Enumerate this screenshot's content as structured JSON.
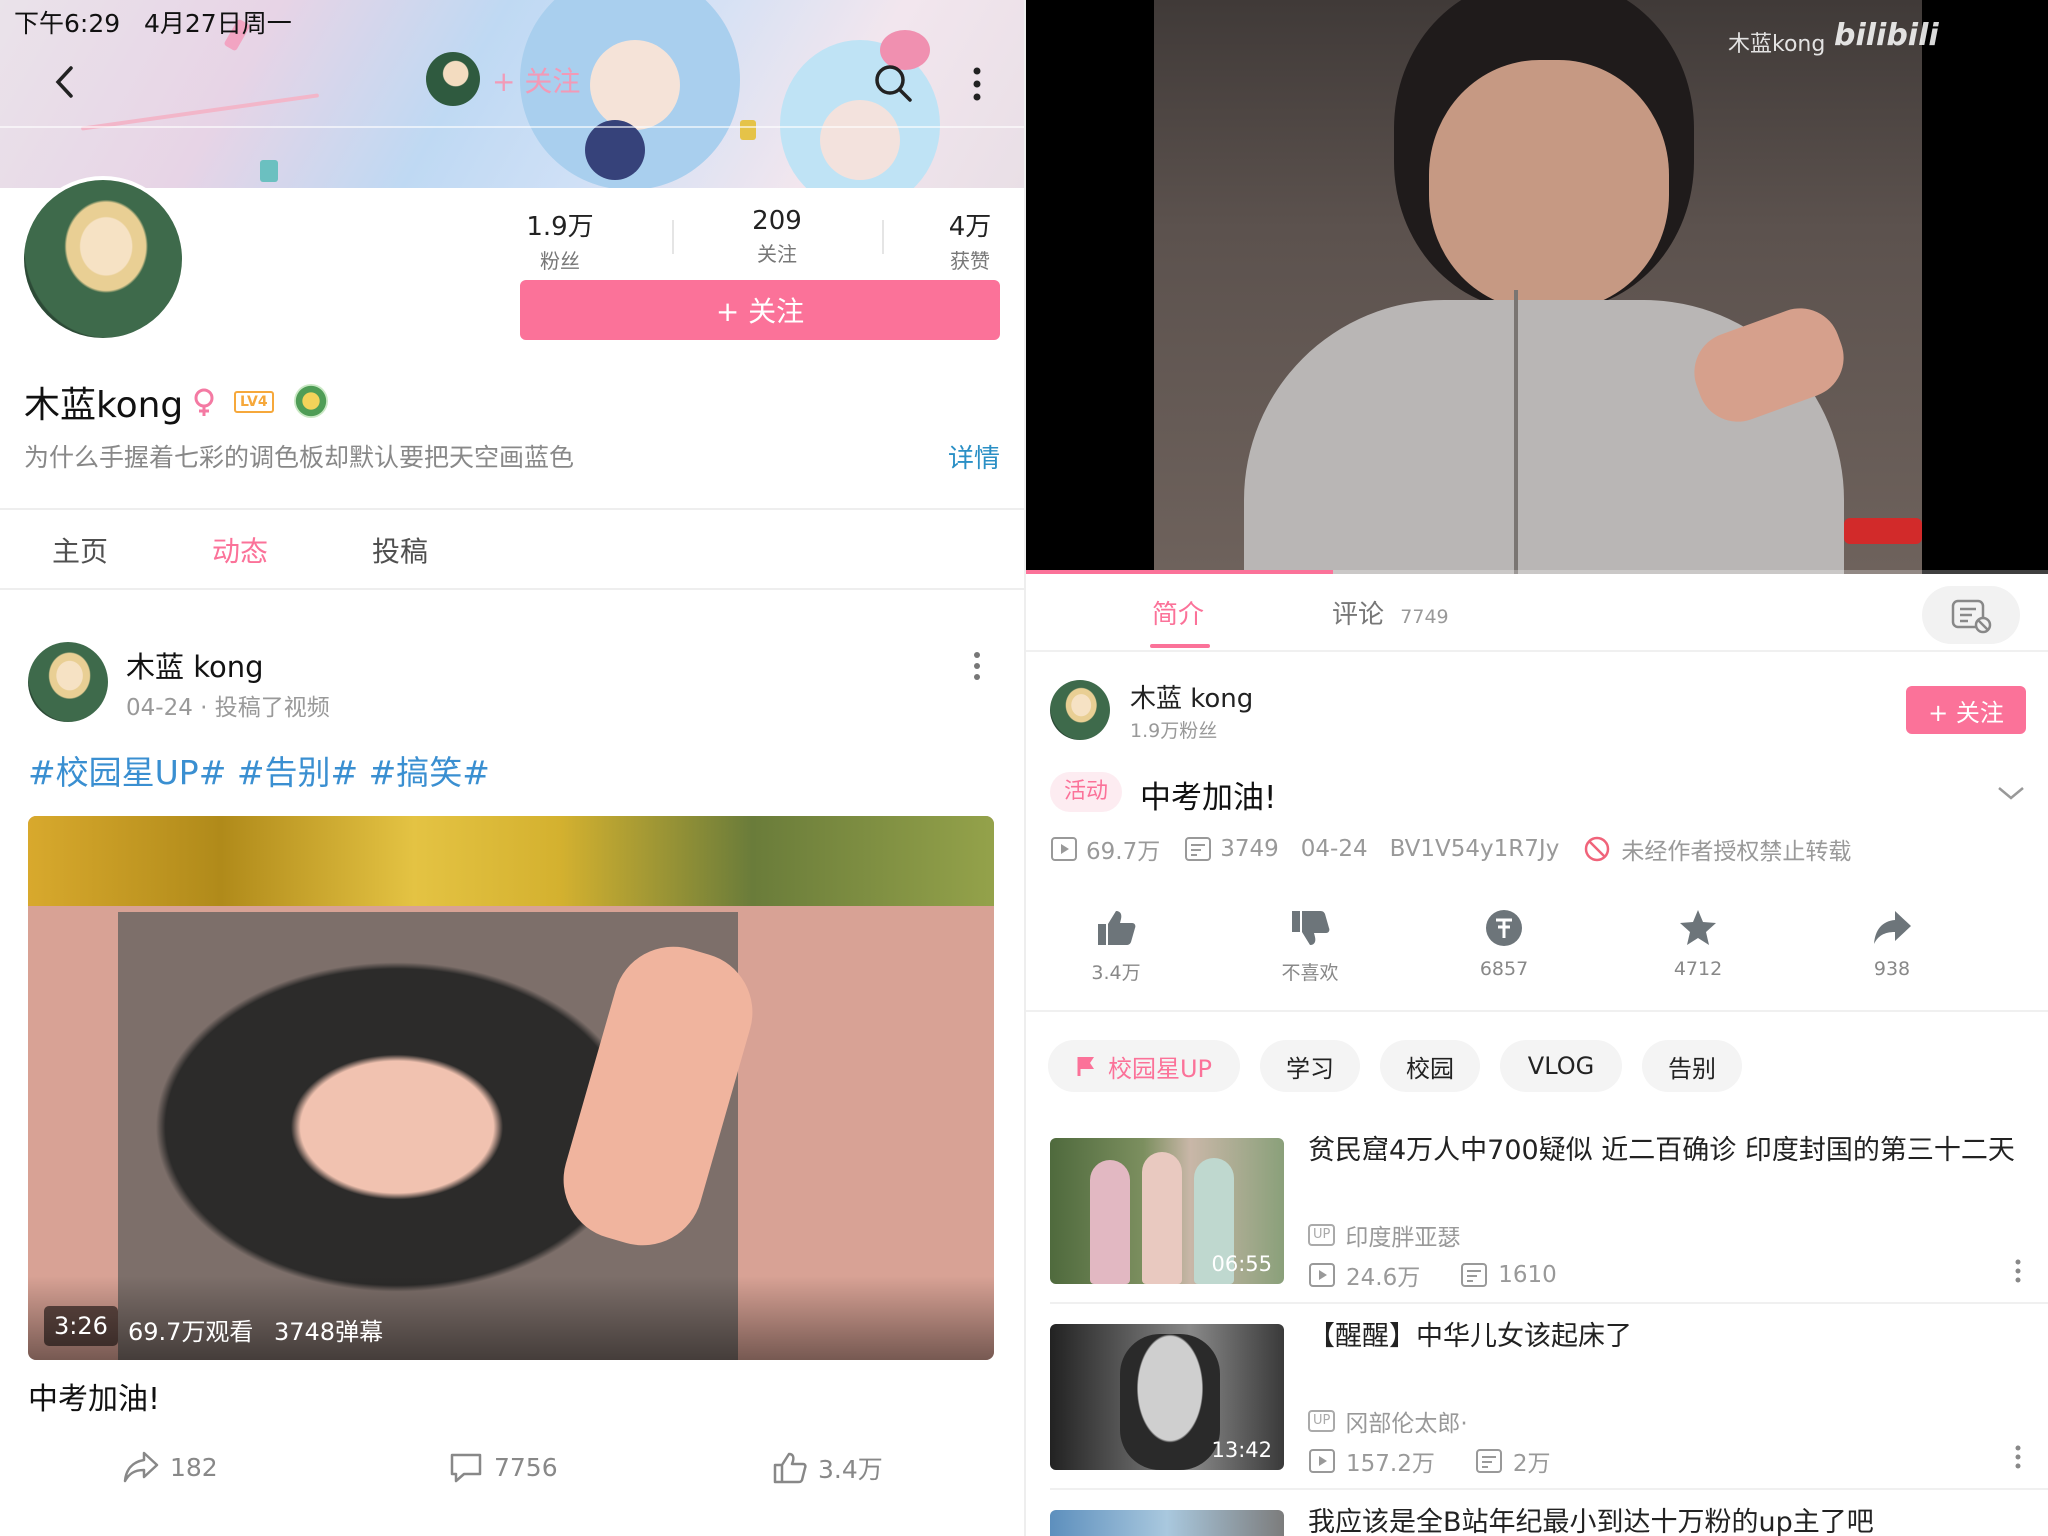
{
  "status_bar": {
    "time": "下午6:29",
    "date": "4月27日周一"
  },
  "colors": {
    "accent": "#fb7299",
    "link": "#2a8fc5",
    "hashtag": "#3a8fd1"
  },
  "profile": {
    "header_follow": "+ 关注",
    "stats": [
      {
        "value": "1.9万",
        "label": "粉丝"
      },
      {
        "value": "209",
        "label": "关注"
      },
      {
        "value": "4万",
        "label": "获赞"
      }
    ],
    "follow_button": "+ 关注",
    "name": "木蓝kong",
    "level_badge": "LV4",
    "bio": "为什么手握着七彩的调色板却默认要把天空画蓝色",
    "details_link": "详情",
    "tabs": [
      "主页",
      "动态",
      "投稿"
    ],
    "active_tab": "动态"
  },
  "post": {
    "author": "木蓝 kong",
    "meta": "04-24 · 投稿了视频",
    "hashtags": "#校园星UP# #告别# #搞笑#",
    "video": {
      "duration": "3:26",
      "views": "69.7万观看",
      "danmaku": "3748弹幕"
    },
    "title": "中考加油!",
    "actions": {
      "share": "182",
      "comment": "7756",
      "like": "3.4万"
    }
  },
  "player": {
    "watermark_user": "木蓝kong",
    "watermark_brand": "bilibili",
    "progress": 0.3
  },
  "video_detail": {
    "tabs": {
      "intro": "简介",
      "comments": "评论",
      "comments_count": "7749"
    },
    "uploader": {
      "name": "木蓝 kong",
      "fans": "1.9万粉丝",
      "follow": "+ 关注"
    },
    "activity_badge": "活动",
    "title": "中考加油!",
    "stats": {
      "views": "69.7万",
      "danmaku": "3749",
      "date": "04-24",
      "bvid": "BV1V54y1R7Jy",
      "notice": "未经作者授权禁止转载"
    },
    "actions": [
      {
        "icon": "thumbs-up-icon",
        "label": "3.4万"
      },
      {
        "icon": "thumbs-down-icon",
        "label": "不喜欢"
      },
      {
        "icon": "coin-icon",
        "label": "6857"
      },
      {
        "icon": "star-icon",
        "label": "4712"
      },
      {
        "icon": "share-icon",
        "label": "938"
      }
    ],
    "tags": [
      "校园星UP",
      "学习",
      "校园",
      "VLOG",
      "告别"
    ]
  },
  "recommendations": [
    {
      "title": "贫民窟4万人中700疑似  近二百确诊  印度封国的第三十二天",
      "up": "印度胖亚瑟",
      "views": "24.6万",
      "danmaku": "1610",
      "duration": "06:55"
    },
    {
      "title": "【醒醒】中华儿女该起床了",
      "up": "冈部伦太郎·",
      "views": "157.2万",
      "danmaku": "2万",
      "duration": "13:42"
    },
    {
      "title": "我应该是全B站年纪最小到达十万粉的up主了吧"
    }
  ]
}
